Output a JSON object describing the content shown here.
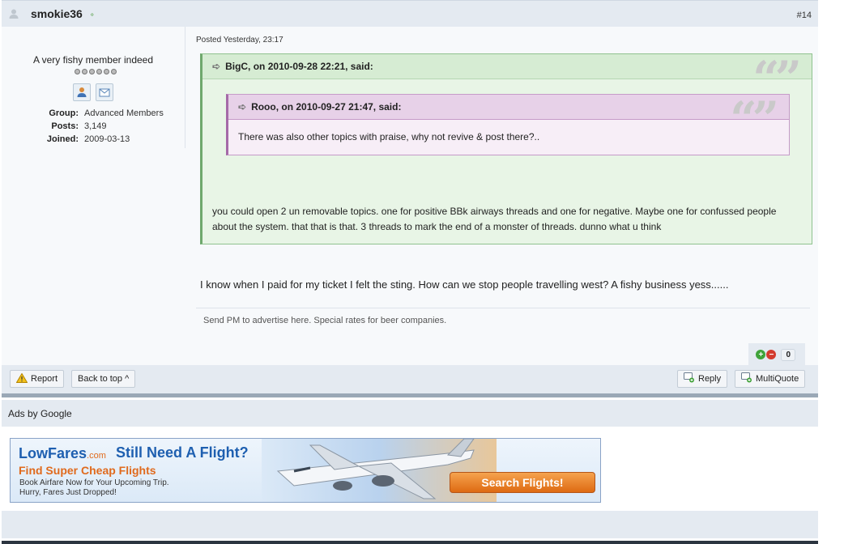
{
  "header": {
    "username": "smokie36",
    "post_number": "#14"
  },
  "author": {
    "member_title": "A very fishy member indeed",
    "info": [
      {
        "label": "Group:",
        "value": "Advanced Members"
      },
      {
        "label": "Posts:",
        "value": "3,149"
      },
      {
        "label": "Joined:",
        "value": "2009-03-13"
      }
    ]
  },
  "post": {
    "posted": "Posted Yesterday, 23:17",
    "outer_quote": {
      "citation": "BigC, on 2010-09-28 22:21, said:",
      "text": "you could open 2 un removable topics. one for positive BBk airways threads and one for negative. Maybe one for confussed people about the system. that that is that. 3 threads to mark the end of a monster of threads. dunno what u think"
    },
    "inner_quote": {
      "citation": "Rooo, on 2010-09-27 21:47, said:",
      "text": "There was also other topics with praise, why not revive & post there?.."
    },
    "reply": "I know when I paid for my ticket I felt the sting. How can we stop people travelling west? A fishy business yess......",
    "signature": "Send PM to advertise here. Special rates for beer companies.",
    "reputation": "0"
  },
  "controls": {
    "report": "Report",
    "back_to_top": "Back to top ^",
    "reply": "Reply",
    "multiquote": "MultiQuote"
  },
  "ads": {
    "label": "Ads by Google",
    "banner": {
      "brand": "LowFares",
      "brand_suffix": ".com",
      "headline": "Still Need A Flight?",
      "subhead": "Find Super Cheap Flights",
      "line1": "Book Airfare Now for Your Upcoming Trip.",
      "line2": "Hurry, Fares Just Dropped!",
      "button": "Search Flights!"
    }
  },
  "colors": {
    "header_bg": "#e4eaf1",
    "outer_quote_border": "#6fa86d",
    "inner_quote_border": "#a56aa8",
    "banner_button": "#de6a12"
  }
}
